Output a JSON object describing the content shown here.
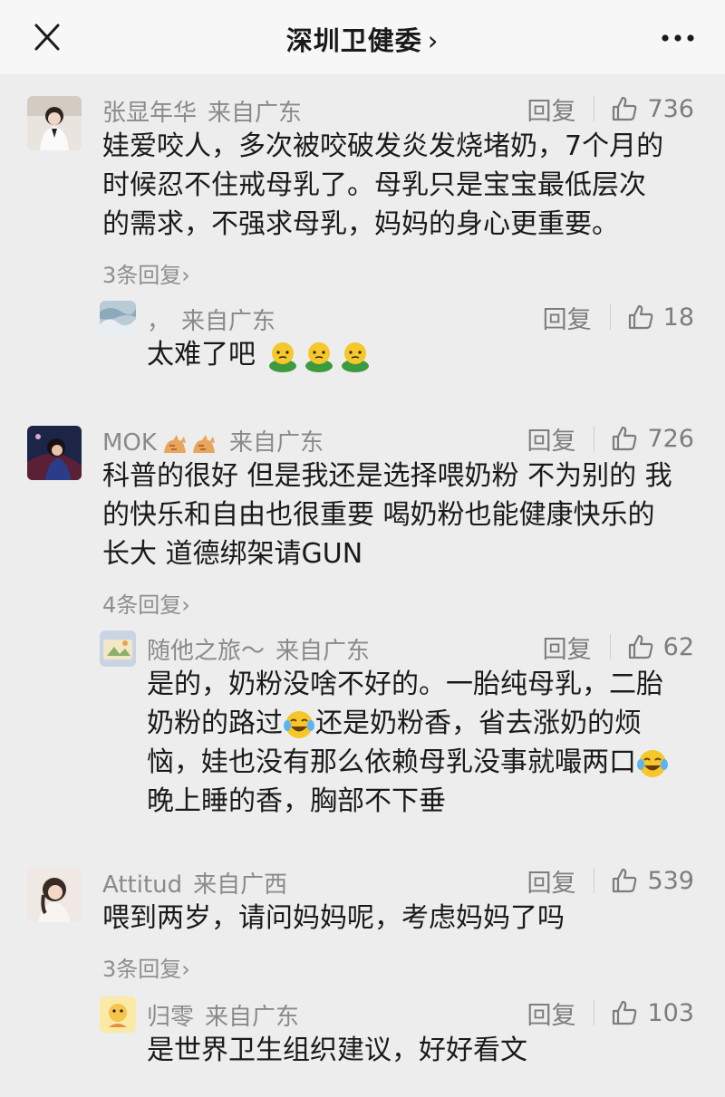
{
  "header": {
    "title": "深圳卫健委",
    "chevron": "›"
  },
  "comments": [
    {
      "name": "张显年华",
      "location": "来自广东",
      "reply_label": "回复",
      "likes": "736",
      "text": [
        "娃爱咬人，多次被咬破发炎发烧堵奶，7个月的",
        "时候忍不住戒母乳了。母乳只是宝宝最低层次",
        "的需求，不强求母乳，妈妈的身心更重要。"
      ],
      "more": "3条回复›",
      "reply": {
        "name": "，",
        "location": "来自广东",
        "reply_label": "回复",
        "likes": "18",
        "text": [
          "太难了吧"
        ]
      }
    },
    {
      "name": "MOK",
      "location": "来自广东",
      "reply_label": "回复",
      "likes": "726",
      "text": [
        "科普的很好 但是我还是选择喂奶粉 不为别的 我",
        "的快乐和自由也很重要 喝奶粉也能健康快乐的",
        "长大 道德绑架请GUN"
      ],
      "more": "4条回复›",
      "reply": {
        "name": "随他之旅～",
        "location": "来自广东",
        "reply_label": "回复",
        "likes": "62",
        "text": [
          "是的，奶粉没啥不好的。一胎纯母乳，二胎",
          "奶粉的路过",
          "还是奶粉香，省去涨奶的烦",
          "恼，娃也没有那么依赖母乳没事就嘬两口",
          "晚上睡的香，胸部不下垂"
        ]
      }
    },
    {
      "name": "Attitud",
      "location": "来自广西",
      "reply_label": "回复",
      "likes": "539",
      "text": [
        "喂到两岁，请问妈妈呢，考虑妈妈了吗"
      ],
      "more": "3条回复›",
      "reply": {
        "name": "归零",
        "location": "来自广东",
        "reply_label": "回复",
        "likes": "103",
        "text": [
          "是世界卫生组织建议，好好看文"
        ]
      }
    }
  ],
  "icons": {
    "close": "close-icon",
    "more": "more-icon",
    "like": "thumbs-up-icon"
  },
  "colors": {
    "background": "#ededed",
    "header": "#f7f7f7",
    "meta": "#8a8a8a",
    "text": "#1a1a1a"
  }
}
